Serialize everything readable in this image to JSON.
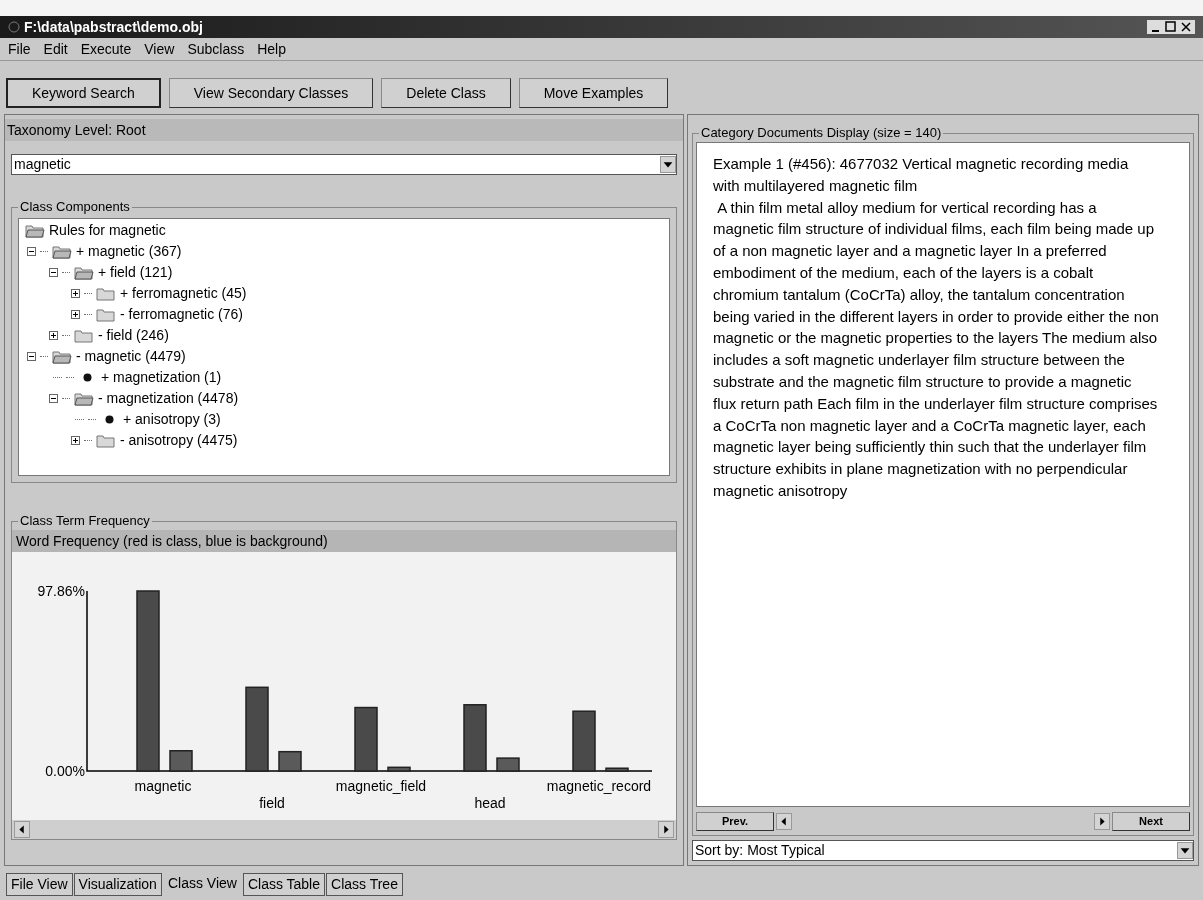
{
  "window": {
    "title": "F:\\data\\pabstract\\demo.obj"
  },
  "menu": [
    "File",
    "Edit",
    "Execute",
    "View",
    "Subclass",
    "Help"
  ],
  "toolbar": [
    {
      "label": "Keyword Search",
      "selected": true
    },
    {
      "label": "View Secondary Classes",
      "selected": false
    },
    {
      "label": "Delete Class",
      "selected": false
    },
    {
      "label": "Move Examples",
      "selected": false
    }
  ],
  "taxonomy": {
    "title": "Taxonomy Level: Root",
    "value": "magnetic"
  },
  "class_components": {
    "title": "Class Components",
    "tree": [
      {
        "label": "Rules for magnetic",
        "kind": "folder",
        "children": [
          {
            "label": "+ magnetic (367)",
            "kind": "folder",
            "expanded": true,
            "children": [
              {
                "label": "+ field (121)",
                "kind": "folder",
                "expanded": true,
                "children": [
                  {
                    "label": "+ ferromagnetic (45)",
                    "kind": "folder",
                    "expanded": false
                  },
                  {
                    "label": "- ferromagnetic (76)",
                    "kind": "folder",
                    "expanded": false
                  }
                ]
              },
              {
                "label": "- field (246)",
                "kind": "folder",
                "expanded": false
              }
            ]
          },
          {
            "label": "- magnetic (4479)",
            "kind": "folder",
            "expanded": true,
            "children": [
              {
                "label": "+ magnetization (1)",
                "kind": "leaf"
              },
              {
                "label": "- magnetization (4478)",
                "kind": "folder",
                "expanded": true,
                "children": [
                  {
                    "label": "+ anisotropy (3)",
                    "kind": "leaf"
                  },
                  {
                    "label": "- anisotropy (4475)",
                    "kind": "folder",
                    "expanded": false
                  }
                ]
              }
            ]
          }
        ]
      }
    ]
  },
  "term_frequency": {
    "title": "Class Term Frequency",
    "chart_title": "Word Frequency (red is class, blue is background)",
    "chart_data": {
      "type": "bar",
      "categories": [
        "magnetic",
        "field",
        "magnetic_field",
        "head",
        "magnetic_record"
      ],
      "series": [
        {
          "color": "#4a4a4a",
          "values": [
            97.86,
            45.5,
            34.5,
            36.0,
            32.5
          ]
        },
        {
          "color": "#5a5a5a",
          "values": [
            11.0,
            10.5,
            2.0,
            7.0,
            1.5
          ]
        }
      ],
      "ylim": [
        0,
        97.86
      ],
      "yticks": [
        {
          "value": 0,
          "label": "0.00%"
        },
        {
          "value": 97.86,
          "label": "97.86%"
        }
      ]
    }
  },
  "documents": {
    "title": "Category Documents Display (size = 140)",
    "heading": "Example 1 (#456): 4677032 Vertical magnetic recording media with multilayered magnetic film",
    "body": " A thin film metal alloy medium for vertical recording has a magnetic film structure of individual films, each film being made up of a non magnetic layer and a magnetic layer In a preferred embodiment of the medium, each of the layers is a cobalt chromium tantalum (CoCrTa) alloy, the tantalum concentration being varied in the different layers in order to provide either the non magnetic or the magnetic properties to the layers The medium also includes a soft magnetic underlayer film structure between the substrate and the magnetic film structure to provide a magnetic flux return path Each film in the underlayer film structure comprises a CoCrTa non magnetic layer and a CoCrTa magnetic layer, each magnetic layer being sufficiently thin such that the underlayer film structure exhibits in plane magnetization with no perpendicular magnetic anisotropy",
    "prev": "Prev.",
    "next": "Next",
    "sort": "Sort by: Most Typical"
  },
  "tabs": [
    {
      "label": "File View",
      "selected": false
    },
    {
      "label": "Visualization",
      "selected": false
    },
    {
      "label": "Class View",
      "selected": true
    },
    {
      "label": "Class Table",
      "selected": false
    },
    {
      "label": "Class Tree",
      "selected": false
    }
  ]
}
